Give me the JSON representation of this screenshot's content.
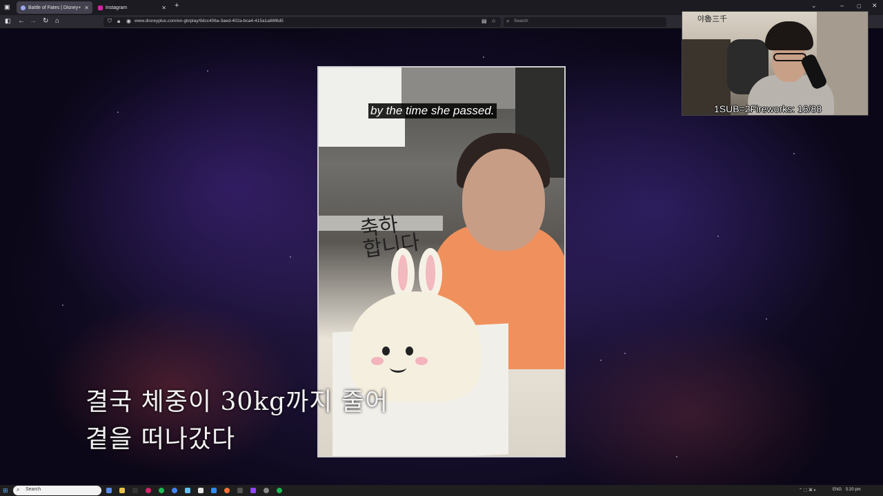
{
  "browser": {
    "tabs": [
      {
        "title": "Battle of Fates | Disney+",
        "active": true,
        "favicon_color": "#9aa4ff"
      },
      {
        "title": "Instagram",
        "active": false,
        "favicon_color": "#d6249f"
      }
    ],
    "new_tab": "+",
    "url": "www.disneyplus.com/en-gb/play/9dcc406a-3aed-402a-bca4-415a1a86f6d5",
    "search_placeholder": "Search"
  },
  "video": {
    "caption": "by the time she passed.",
    "korean_line_1": "결국 체중이 30kg까지 줄어",
    "korean_line_2": "곁을 떠나갔다",
    "in_clip_handwriting": "축하\n합니다"
  },
  "webcam": {
    "logo": "야魯三千",
    "counter": "1SUB=2Fireworks: 16/88"
  },
  "taskbar": {
    "search_label": "Search",
    "language": "ENG",
    "time": "5:20 pm"
  }
}
